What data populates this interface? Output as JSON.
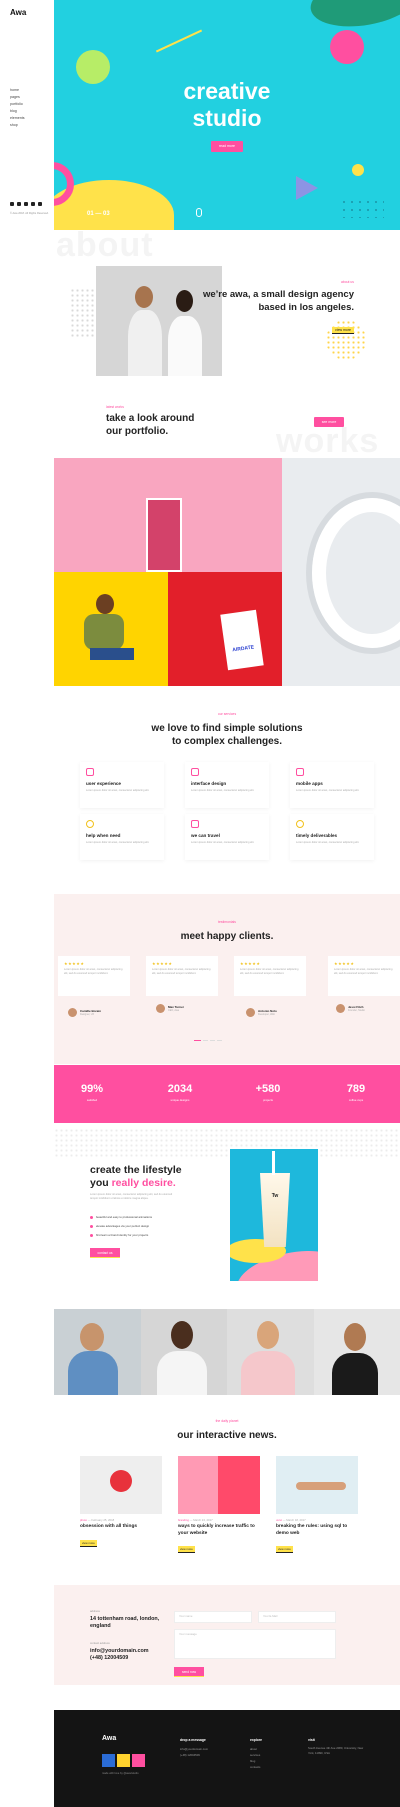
{
  "brand": {
    "logo": "Awa"
  },
  "sidebar": {
    "nav": [
      "home",
      "pages",
      "portfolio",
      "blog",
      "elements",
      "shop"
    ],
    "copyright": "© Awa 2018. All Rights Reserved."
  },
  "hero": {
    "title_line1": "creative",
    "title_line2": "studio",
    "button": "read more",
    "counter": "01 — 03"
  },
  "about": {
    "bg_word": "about",
    "tag": "about us",
    "heading": "we’re awa, a small design agency based in los angeles.",
    "button": "view more"
  },
  "works": {
    "bg_word": "works",
    "tag": "latest works",
    "heading_line1": "take a look around",
    "heading_line2": "our portfolio.",
    "button": "see more",
    "tag_label": "AIRDATE"
  },
  "services": {
    "tag": "our services",
    "heading_line1": "we love to find simple solutions",
    "heading_line2": "to complex challenges.",
    "desc": "Lorem ipsum dolor sit amet, consectetur adipiscing elit.",
    "items": [
      {
        "title": "user experience",
        "icon": "layers-icon"
      },
      {
        "title": "interface design",
        "icon": "pen-icon"
      },
      {
        "title": "mobile apps",
        "icon": "phone-icon"
      },
      {
        "title": "help when need",
        "icon": "lifebuoy-icon"
      },
      {
        "title": "we can travel",
        "icon": "planet-icon"
      },
      {
        "title": "timely deliverables",
        "icon": "smile-icon"
      }
    ]
  },
  "testimonials": {
    "tag": "testimonials",
    "heading": "meet happy clients.",
    "quote": "Lorem ipsum dolor sit amet, consectetur adipiscing elit, sed do eiusmod tempor incididunt.",
    "clients": [
      {
        "name": "Camille Borain",
        "role": "Designer, UX"
      },
      {
        "name": "Max Turner",
        "role": "CEO, Awa"
      },
      {
        "name": "Antonio Nolo",
        "role": "Developer, Web"
      },
      {
        "name": "Jessi Fitch",
        "role": "Founder, Studio"
      }
    ]
  },
  "stats": [
    {
      "value": "99%",
      "label": "satisfied"
    },
    {
      "value": "2034",
      "label": "unique designs"
    },
    {
      "value": "+580",
      "label": "projects"
    },
    {
      "value": "789",
      "label": "coffee cups"
    }
  ],
  "lifestyle": {
    "heading_line1": "create the lifestyle",
    "heading_pre": "you ",
    "heading_accent": "really desire.",
    "para": "Lorem ipsum dolor sit amet, consectetur adipiscing elit, sed do eiusmod tempor incididunt ut labore et dolore magna aliqua.",
    "bullets": [
      "beautiful and easy to professional animations",
      "elevate advantages via your perfect design",
      "first learn a brand identity for your projects"
    ],
    "button": "contact us",
    "cup_label": "Tw"
  },
  "news": {
    "tag": "the daily planet",
    "heading": "our interactive news.",
    "more": "view more",
    "posts": [
      {
        "cat": "photo",
        "date": "February 25, 2018",
        "title": "obsession with all things"
      },
      {
        "cat": "branding",
        "date": "March 24, 2017",
        "title": "ways to quickly increase traffic to your website"
      },
      {
        "cat": "ux/ui",
        "date": "March 18, 2017",
        "title": "breaking the rules: using sql to demo web"
      }
    ]
  },
  "contact": {
    "address_label": "address",
    "address": "14 tottenham road, london, england",
    "email_label": "contact address",
    "email": "info@yourdomain.com",
    "phone": "(+48) 12004509",
    "name_ph": "Your name",
    "email_ph": "Your E-Mail",
    "message_ph": "Your message",
    "send": "send now"
  },
  "footer": {
    "logo": "Awa",
    "made": "made with love by @awa/studio",
    "col1_title": "drop a message",
    "col1": [
      "info@yourdomain.com",
      "(+48) 12004509"
    ],
    "col2_title": "explore",
    "col2": [
      "about",
      "services",
      "blog",
      "contacts"
    ],
    "col3_title": "visit",
    "col3": [
      "South Avenue 4th Ave 2080, University, New York, 11990, USA"
    ]
  },
  "colors": {
    "cyan": "#22d0e0",
    "pink": "#ff4fa0",
    "yellow": "#ffe24a",
    "dark": "#141414"
  }
}
